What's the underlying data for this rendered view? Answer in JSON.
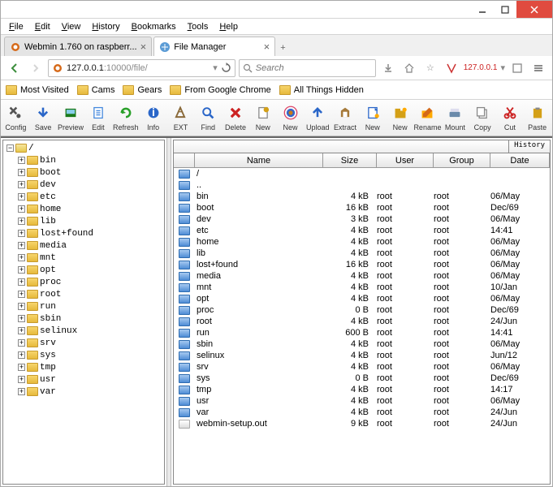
{
  "menu": [
    "File",
    "Edit",
    "View",
    "History",
    "Bookmarks",
    "Tools",
    "Help"
  ],
  "tabs": [
    {
      "title": "Webmin 1.760 on raspberr...",
      "active": false
    },
    {
      "title": "File Manager",
      "active": true
    }
  ],
  "url": {
    "host": "127.0.0.1",
    "port": ":10000",
    "path": "/file/"
  },
  "search_placeholder": "Search",
  "ip_label": "127.0.0.1",
  "bookmarks": [
    "Most Visited",
    "Cams",
    "Gears",
    "From Google Chrome",
    "All Things Hidden"
  ],
  "toolbar": [
    {
      "id": "config",
      "label": "Config",
      "color": "#555"
    },
    {
      "id": "save",
      "label": "Save",
      "color": "#2a66c8"
    },
    {
      "id": "preview",
      "label": "Preview",
      "color": "#1a7a1a"
    },
    {
      "id": "edit",
      "label": "Edit",
      "color": "#4488dd"
    },
    {
      "id": "refresh",
      "label": "Refresh",
      "color": "#2aa02a"
    },
    {
      "id": "info",
      "label": "Info",
      "color": "#2a66c8"
    },
    {
      "id": "ext",
      "label": "EXT",
      "color": "#8a6a3a"
    },
    {
      "id": "find",
      "label": "Find",
      "color": "#2a66c8"
    },
    {
      "id": "delete",
      "label": "Delete",
      "color": "#cc2222"
    },
    {
      "id": "new1",
      "label": "New",
      "color": "#d4a017"
    },
    {
      "id": "new2",
      "label": "New",
      "color": "#c97a1a"
    },
    {
      "id": "upload",
      "label": "Upload",
      "color": "#2a66c8"
    },
    {
      "id": "extract",
      "label": "Extract",
      "color": "#a67a3a"
    },
    {
      "id": "new3",
      "label": "New",
      "color": "#2a66c8"
    },
    {
      "id": "new4",
      "label": "New",
      "color": "#d4a017"
    },
    {
      "id": "rename",
      "label": "Rename",
      "color": "#d46a1a"
    },
    {
      "id": "mount",
      "label": "Mount",
      "color": "#6a8aaa"
    },
    {
      "id": "copy",
      "label": "Copy",
      "color": "#888"
    },
    {
      "id": "cut",
      "label": "Cut",
      "color": "#cc2222"
    },
    {
      "id": "paste",
      "label": "Paste",
      "color": "#d4a017"
    }
  ],
  "tree_root": "/",
  "tree": [
    "bin",
    "boot",
    "dev",
    "etc",
    "home",
    "lib",
    "lost+found",
    "media",
    "mnt",
    "opt",
    "proc",
    "root",
    "run",
    "sbin",
    "selinux",
    "srv",
    "sys",
    "tmp",
    "usr",
    "var"
  ],
  "history_label": "History",
  "columns": {
    "name": "Name",
    "size": "Size",
    "user": "User",
    "group": "Group",
    "date": "Date"
  },
  "path_row": "/",
  "dotdot": "..",
  "files": [
    {
      "n": "bin",
      "s": "4 kB",
      "u": "root",
      "g": "root",
      "d": "06/May",
      "t": "folder"
    },
    {
      "n": "boot",
      "s": "16 kB",
      "u": "root",
      "g": "root",
      "d": "Dec/69",
      "t": "folder"
    },
    {
      "n": "dev",
      "s": "3 kB",
      "u": "root",
      "g": "root",
      "d": "06/May",
      "t": "folder"
    },
    {
      "n": "etc",
      "s": "4 kB",
      "u": "root",
      "g": "root",
      "d": "14:41",
      "t": "folder"
    },
    {
      "n": "home",
      "s": "4 kB",
      "u": "root",
      "g": "root",
      "d": "06/May",
      "t": "folder"
    },
    {
      "n": "lib",
      "s": "4 kB",
      "u": "root",
      "g": "root",
      "d": "06/May",
      "t": "folder"
    },
    {
      "n": "lost+found",
      "s": "16 kB",
      "u": "root",
      "g": "root",
      "d": "06/May",
      "t": "folder"
    },
    {
      "n": "media",
      "s": "4 kB",
      "u": "root",
      "g": "root",
      "d": "06/May",
      "t": "folder"
    },
    {
      "n": "mnt",
      "s": "4 kB",
      "u": "root",
      "g": "root",
      "d": "10/Jan",
      "t": "folder"
    },
    {
      "n": "opt",
      "s": "4 kB",
      "u": "root",
      "g": "root",
      "d": "06/May",
      "t": "folder"
    },
    {
      "n": "proc",
      "s": "0 B",
      "u": "root",
      "g": "root",
      "d": "Dec/69",
      "t": "folder"
    },
    {
      "n": "root",
      "s": "4 kB",
      "u": "root",
      "g": "root",
      "d": "24/Jun",
      "t": "folder"
    },
    {
      "n": "run",
      "s": "600 B",
      "u": "root",
      "g": "root",
      "d": "14:41",
      "t": "folder"
    },
    {
      "n": "sbin",
      "s": "4 kB",
      "u": "root",
      "g": "root",
      "d": "06/May",
      "t": "folder"
    },
    {
      "n": "selinux",
      "s": "4 kB",
      "u": "root",
      "g": "root",
      "d": "Jun/12",
      "t": "folder"
    },
    {
      "n": "srv",
      "s": "4 kB",
      "u": "root",
      "g": "root",
      "d": "06/May",
      "t": "folder"
    },
    {
      "n": "sys",
      "s": "0 B",
      "u": "root",
      "g": "root",
      "d": "Dec/69",
      "t": "folder"
    },
    {
      "n": "tmp",
      "s": "4 kB",
      "u": "root",
      "g": "root",
      "d": "14:17",
      "t": "folder"
    },
    {
      "n": "usr",
      "s": "4 kB",
      "u": "root",
      "g": "root",
      "d": "06/May",
      "t": "folder"
    },
    {
      "n": "var",
      "s": "4 kB",
      "u": "root",
      "g": "root",
      "d": "24/Jun",
      "t": "folder"
    },
    {
      "n": "webmin-setup.out",
      "s": "9 kB",
      "u": "root",
      "g": "root",
      "d": "24/Jun",
      "t": "file"
    }
  ]
}
